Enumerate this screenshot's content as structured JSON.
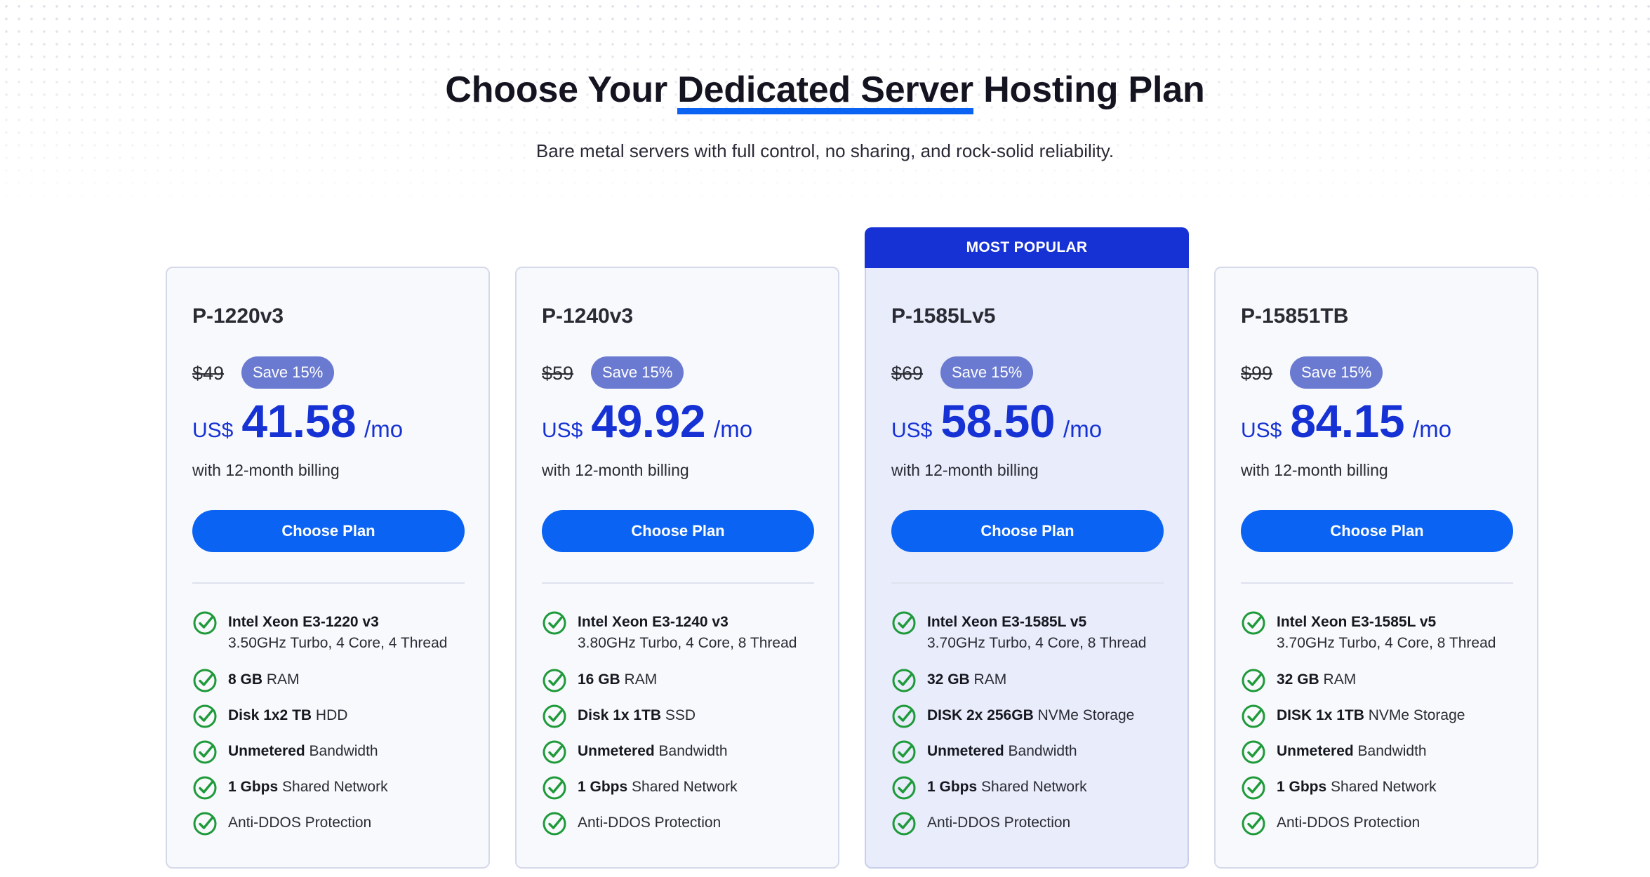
{
  "header": {
    "title_pre": "Choose Your",
    "title_highlight": "Dedicated Server",
    "title_post": "Hosting Plan",
    "subtitle": "Bare metal servers with full control, no sharing, and rock-solid reliability."
  },
  "colors": {
    "accent_blue": "#0a63f2",
    "popular_band": "#1632d4",
    "price_blue": "#1632d4",
    "save_badge": "#6a7ad0",
    "check_green": "#1f9a3a"
  },
  "plans": [
    {
      "name": "P-1220v3",
      "old_price": "$49",
      "save": "Save 15%",
      "currency": "US$",
      "amount": "41.58",
      "per": "/mo",
      "billing": "with 12-month billing",
      "button": "Choose Plan",
      "popular": false,
      "cpu_bold": "Intel Xeon E3-1220 v3",
      "cpu_detail": "3.50GHz Turbo, 4 Core, 4 Thread",
      "ram_bold": "8 GB",
      "ram_rest": "RAM",
      "disk_bold": "Disk 1x2 TB",
      "disk_rest": "HDD",
      "bw_bold": "Unmetered",
      "bw_rest": "Bandwidth",
      "net_bold": "1 Gbps",
      "net_rest": "Shared Network",
      "ddos": "Anti-DDOS Protection"
    },
    {
      "name": "P-1240v3",
      "old_price": "$59",
      "save": "Save 15%",
      "currency": "US$",
      "amount": "49.92",
      "per": "/mo",
      "billing": "with 12-month billing",
      "button": "Choose Plan",
      "popular": false,
      "cpu_bold": "Intel Xeon E3-1240 v3",
      "cpu_detail": "3.80GHz Turbo, 4 Core, 8 Thread",
      "ram_bold": "16 GB",
      "ram_rest": "RAM",
      "disk_bold": "Disk 1x 1TB",
      "disk_rest": "SSD",
      "bw_bold": "Unmetered",
      "bw_rest": "Bandwidth",
      "net_bold": "1 Gbps",
      "net_rest": "Shared Network",
      "ddos": "Anti-DDOS Protection"
    },
    {
      "name": "P-1585Lv5",
      "old_price": "$69",
      "save": "Save 15%",
      "currency": "US$",
      "amount": "58.50",
      "per": "/mo",
      "billing": "with 12-month billing",
      "button": "Choose Plan",
      "popular": true,
      "popular_label": "MOST POPULAR",
      "cpu_bold": "Intel Xeon E3-1585L v5",
      "cpu_detail": "3.70GHz Turbo, 4 Core, 8 Thread",
      "ram_bold": "32 GB",
      "ram_rest": "RAM",
      "disk_bold": "DISK 2x 256GB",
      "disk_rest": "NVMe Storage",
      "bw_bold": "Unmetered",
      "bw_rest": "Bandwidth",
      "net_bold": "1 Gbps",
      "net_rest": "Shared Network",
      "ddos": "Anti-DDOS Protection"
    },
    {
      "name": "P-15851TB",
      "old_price": "$99",
      "save": "Save 15%",
      "currency": "US$",
      "amount": "84.15",
      "per": "/mo",
      "billing": "with 12-month billing",
      "button": "Choose Plan",
      "popular": false,
      "cpu_bold": "Intel Xeon E3-1585L v5",
      "cpu_detail": "3.70GHz Turbo, 4 Core, 8 Thread",
      "ram_bold": "32 GB",
      "ram_rest": "RAM",
      "disk_bold": "DISK 1x 1TB",
      "disk_rest": "NVMe Storage",
      "bw_bold": "Unmetered",
      "bw_rest": "Bandwidth",
      "net_bold": "1 Gbps",
      "net_rest": "Shared Network",
      "ddos": "Anti-DDOS Protection"
    }
  ]
}
